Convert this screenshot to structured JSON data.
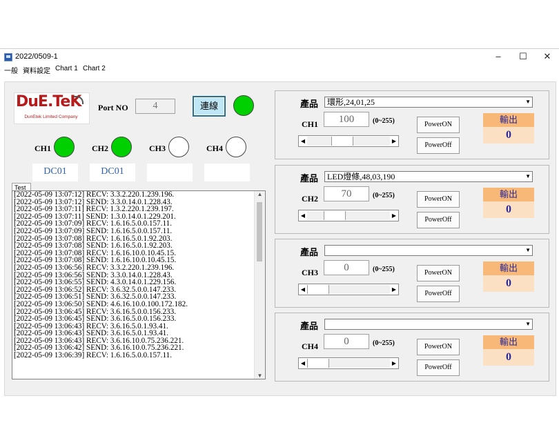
{
  "window": {
    "title": "2022/0509-1",
    "minimize": "–",
    "maximize": "☐",
    "close": "✕"
  },
  "menu": [
    "一般",
    "資料設定",
    "Chart 1",
    "Chart 2"
  ],
  "logo": {
    "text": "DuE.TeK",
    "subtitle": "DunEtek Limited Company"
  },
  "port": {
    "label": "Port NO",
    "value": "4"
  },
  "connect": {
    "label": "連線",
    "status_color": "#00d000"
  },
  "channels": [
    {
      "label": "CH1",
      "on": true,
      "device": "DC01"
    },
    {
      "label": "CH2",
      "on": true,
      "device": "DC01"
    },
    {
      "label": "CH3",
      "on": false,
      "device": ""
    },
    {
      "label": "CH4",
      "on": false,
      "device": ""
    }
  ],
  "log": {
    "tab": "Test",
    "lines": [
      "[2022-05-09 13:07:12] RECV: 3.3.2.220.1.239.196.",
      "[2022-05-09 13:07:12] SEND: 3.3.0.14.0.1.228.43.",
      "[2022-05-09 13:07:11] RECV: 1.3.2.220.1.239.197.",
      "[2022-05-09 13:07:11] SEND: 1.3.0.14.0.1.229.201.",
      "[2022-05-09 13:07:09] RECV: 1.6.16.5.0.0.157.11.",
      "[2022-05-09 13:07:09] SEND: 1.6.16.5.0.0.157.11.",
      "[2022-05-09 13:07:08] RECV: 1.6.16.5.0.1.92.203.",
      "[2022-05-09 13:07:08] SEND: 1.6.16.5.0.1.92.203.",
      "[2022-05-09 13:07:08] RECV: 1.6.16.10.0.10.45.15.",
      "[2022-05-09 13:07:08] SEND: 1.6.16.10.0.10.45.15.",
      "[2022-05-09 13:06:56] RECV: 3.3.2.220.1.239.196.",
      "[2022-05-09 13:06:56] SEND: 3.3.0.14.0.1.228.43.",
      "[2022-05-09 13:06:55] SEND: 4.3.0.14.0.1.229.156.",
      "[2022-05-09 13:06:52] RECV: 3.6.32.5.0.0.147.233.",
      "[2022-05-09 13:06:51] SEND: 3.6.32.5.0.0.147.233.",
      "[2022-05-09 13:06:50] SEND: 4.6.16.10.0.100.172.182.",
      "[2022-05-09 13:06:45] RECV: 3.6.16.5.0.0.156.233.",
      "[2022-05-09 13:06:45] SEND: 3.6.16.5.0.0.156.233.",
      "[2022-05-09 13:06:43] RECV: 3.6.16.5.0.1.93.41.",
      "[2022-05-09 13:06:43] SEND: 3.6.16.5.0.1.93.41.",
      "[2022-05-09 13:06:43] RECV: 3.6.16.10.0.75.236.221.",
      "[2022-05-09 13:06:42] SEND: 3.6.16.10.0.75.236.221.",
      "[2022-05-09 13:06:39] RECV: 1.6.16.5.0.0.157.11."
    ]
  },
  "groups": [
    {
      "product_label": "產品",
      "product": "環形,24,01,25",
      "ch": "CH1",
      "value": "100",
      "range": "(0~255)",
      "slider_fraction": 0.39,
      "power_on": "PowerON",
      "power_off": "PowerOff",
      "output_label": "輸出",
      "output_value": "0"
    },
    {
      "product_label": "產品",
      "product": "LED燈條,48,03,190",
      "ch": "CH2",
      "value": "70",
      "range": "(0~255)",
      "slider_fraction": 0.27,
      "power_on": "PowerON",
      "power_off": "PowerOff",
      "output_label": "輸出",
      "output_value": "0"
    },
    {
      "product_label": "產品",
      "product": "",
      "ch": "CH3",
      "value": "0",
      "range": "(0~255)",
      "slider_fraction": 0.0,
      "power_on": "PowerON",
      "power_off": "PowerOff",
      "output_label": "輸出",
      "output_value": "0"
    },
    {
      "product_label": "產品",
      "product": "",
      "ch": "CH4",
      "value": "0",
      "range": "(0~255)",
      "slider_fraction": 0.0,
      "power_on": "PowerON",
      "power_off": "PowerOff",
      "output_label": "輸出",
      "output_value": "0"
    }
  ]
}
